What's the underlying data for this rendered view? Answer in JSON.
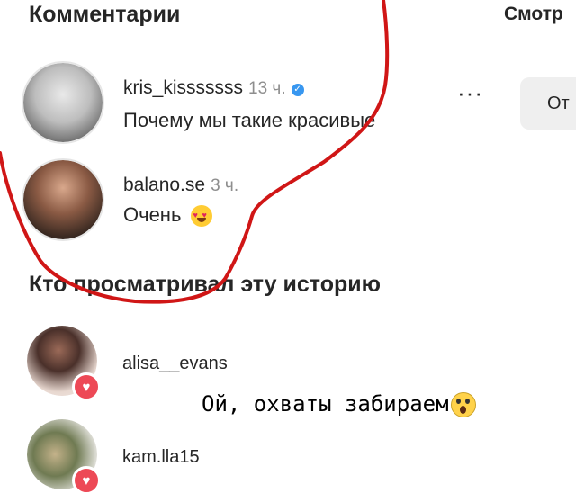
{
  "comments_section": {
    "title": "Комментарии",
    "view_all": "Смотр",
    "reply_button": "От",
    "more_icon": "ellipsis-icon",
    "items": [
      {
        "username": "kris_kisssssss",
        "time": "13 ч.",
        "verified": true,
        "text": "Почему мы такие красивые"
      },
      {
        "username": "balano.se",
        "time": "3 ч.",
        "verified": false,
        "text": "Очень",
        "emoji": "heart-eyes-emoji"
      }
    ]
  },
  "viewers_section": {
    "title": "Кто просматривал эту историю",
    "items": [
      {
        "username": "alisa__evans",
        "badge": "heart-icon"
      },
      {
        "username": "kam.lla15",
        "badge": "heart-icon"
      }
    ]
  },
  "overlay_caption": {
    "text": "Ой, охваты забираем",
    "emoji": "scream-emoji"
  },
  "colors": {
    "annotation_red": "#d01616",
    "like_red": "#ed4956",
    "verified_blue": "#3897f0"
  }
}
